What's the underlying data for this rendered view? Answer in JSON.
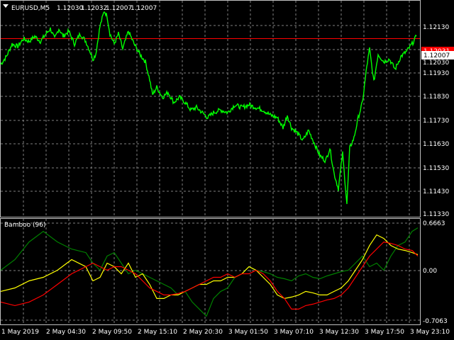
{
  "price_panel": {
    "symbol": "EURUSD,M5",
    "ohlc": [
      "1.12030",
      "1.12032",
      "1.12007",
      "1.12007"
    ],
    "price_labels": [
      "1.12130",
      "1.12030",
      "1.11930",
      "1.11830",
      "1.11730",
      "1.11630",
      "1.11530",
      "1.11430",
      "1.11330"
    ],
    "current_bid": "1.12007",
    "ask_line_label": "1.12031",
    "line_color": "#00ff00",
    "ask_line_color": "#ff0000"
  },
  "indicator_panel": {
    "name": "Bamboo (96)",
    "level_labels": [
      "0.6663",
      "0.00",
      "-0.7063"
    ],
    "series_colors": {
      "dark_green": "#008000",
      "yellow": "#ffff00",
      "red": "#ff0000"
    }
  },
  "time_labels": [
    "1 May 2019",
    "2 May 04:30",
    "2 May 09:50",
    "2 May 15:10",
    "2 May 20:30",
    "3 May 01:50",
    "3 May 07:10",
    "3 May 12:30",
    "3 May 17:50",
    "3 May 23:10"
  ],
  "chart_data": {
    "type": "line",
    "title": "EURUSD,M5",
    "x_range": [
      "1 May 2019",
      "3 May 23:10"
    ],
    "price": {
      "ylim": [
        1.1133,
        1.1218
      ],
      "x": [
        0,
        8,
        16,
        24,
        32,
        40,
        48,
        56,
        64,
        70,
        76,
        82,
        88,
        96,
        104,
        112,
        120,
        126,
        130,
        134,
        140,
        146,
        150,
        154,
        160,
        166,
        172,
        180,
        188,
        196,
        204,
        210,
        214,
        220,
        228,
        236,
        244,
        252,
        260,
        268,
        276,
        284,
        292,
        300,
        310,
        320,
        330,
        340,
        350,
        360,
        370,
        380,
        390,
        398,
        404,
        410,
        418,
        426,
        434,
        442,
        450,
        458,
        464,
        470,
        476,
        482,
        488,
        492,
        498,
        504,
        510,
        516,
        520,
        526,
        532,
        540,
        548,
        556,
        564,
        572,
        580,
        586
      ],
      "close": [
        1.1193,
        1.1196,
        1.1201,
        1.12,
        1.1203,
        1.1202,
        1.1204,
        1.1202,
        1.1205,
        1.1207,
        1.1203,
        1.1207,
        1.1204,
        1.1206,
        1.1201,
        1.1205,
        1.1202,
        1.1198,
        1.1195,
        1.1197,
        1.1208,
        1.1214,
        1.1212,
        1.1205,
        1.1201,
        1.1205,
        1.1199,
        1.1206,
        1.1201,
        1.1197,
        1.1194,
        1.1187,
        1.1181,
        1.1184,
        1.118,
        1.1182,
        1.1178,
        1.118,
        1.1178,
        1.1175,
        1.1176,
        1.1174,
        1.1172,
        1.1174,
        1.1175,
        1.1174,
        1.1177,
        1.1176,
        1.1177,
        1.1176,
        1.1175,
        1.1173,
        1.1172,
        1.1168,
        1.1173,
        1.1168,
        1.1166,
        1.1163,
        1.1167,
        1.1162,
        1.1157,
        1.1155,
        1.116,
        1.115,
        1.1144,
        1.1158,
        1.1138,
        1.116,
        1.1164,
        1.1172,
        1.1178,
        1.1192,
        1.1199,
        1.1186,
        1.1197,
        1.1194,
        1.1195,
        1.1191,
        1.1196,
        1.1198,
        1.1201,
        1.1204
      ]
    },
    "indicator": {
      "name": "Bamboo (96)",
      "ylim": [
        -0.7063,
        0.6663
      ],
      "x": [
        0,
        20,
        40,
        60,
        80,
        100,
        120,
        130,
        140,
        150,
        160,
        170,
        180,
        190,
        200,
        210,
        220,
        230,
        240,
        250,
        260,
        270,
        280,
        290,
        300,
        310,
        320,
        330,
        340,
        350,
        360,
        370,
        380,
        390,
        400,
        410,
        420,
        430,
        440,
        450,
        460,
        470,
        480,
        490,
        500,
        510,
        520,
        530,
        540,
        550,
        560,
        570,
        580,
        588
      ],
      "series": [
        {
          "values": [
            0.0,
            0.15,
            0.4,
            0.55,
            0.4,
            0.3,
            0.25,
            0.1,
            0.0,
            0.2,
            0.25,
            0.1,
            -0.05,
            0.0,
            -0.05,
            -0.1,
            -0.15,
            -0.2,
            -0.25,
            -0.35,
            -0.3,
            -0.45,
            -0.55,
            -0.65,
            -0.4,
            -0.3,
            -0.25,
            -0.1,
            -0.05,
            0.05,
            0.0,
            -0.02,
            -0.05,
            -0.1,
            -0.12,
            -0.15,
            -0.08,
            -0.05,
            -0.1,
            -0.12,
            -0.08,
            -0.05,
            -0.02,
            0.0,
            0.1,
            0.2,
            0.05,
            0.1,
            0.0,
            0.2,
            0.35,
            0.4,
            0.55,
            0.6
          ]
        },
        {
          "values": [
            -0.3,
            -0.25,
            -0.15,
            -0.1,
            0.0,
            0.15,
            0.05,
            -0.15,
            -0.1,
            0.1,
            0.05,
            -0.05,
            0.1,
            -0.1,
            -0.05,
            -0.2,
            -0.4,
            -0.4,
            -0.35,
            -0.35,
            -0.3,
            -0.25,
            -0.2,
            -0.2,
            -0.15,
            -0.15,
            -0.1,
            -0.1,
            -0.05,
            0.05,
            0.0,
            -0.1,
            -0.2,
            -0.35,
            -0.4,
            -0.38,
            -0.35,
            -0.3,
            -0.32,
            -0.35,
            -0.35,
            -0.3,
            -0.25,
            -0.15,
            0.0,
            0.15,
            0.35,
            0.5,
            0.45,
            0.35,
            0.3,
            0.28,
            0.25,
            0.22
          ]
        },
        {
          "values": [
            -0.45,
            -0.5,
            -0.45,
            -0.35,
            -0.2,
            -0.05,
            0.05,
            0.1,
            0.05,
            0.0,
            0.05,
            0.05,
            0.0,
            -0.05,
            -0.15,
            -0.25,
            -0.3,
            -0.35,
            -0.35,
            -0.33,
            -0.3,
            -0.25,
            -0.2,
            -0.15,
            -0.1,
            -0.1,
            -0.05,
            -0.1,
            -0.05,
            -0.05,
            0.0,
            -0.05,
            -0.15,
            -0.3,
            -0.4,
            -0.55,
            -0.55,
            -0.5,
            -0.48,
            -0.45,
            -0.42,
            -0.4,
            -0.35,
            -0.25,
            -0.1,
            0.05,
            0.2,
            0.3,
            0.4,
            0.38,
            0.35,
            0.3,
            0.28,
            0.2
          ]
        }
      ]
    }
  }
}
